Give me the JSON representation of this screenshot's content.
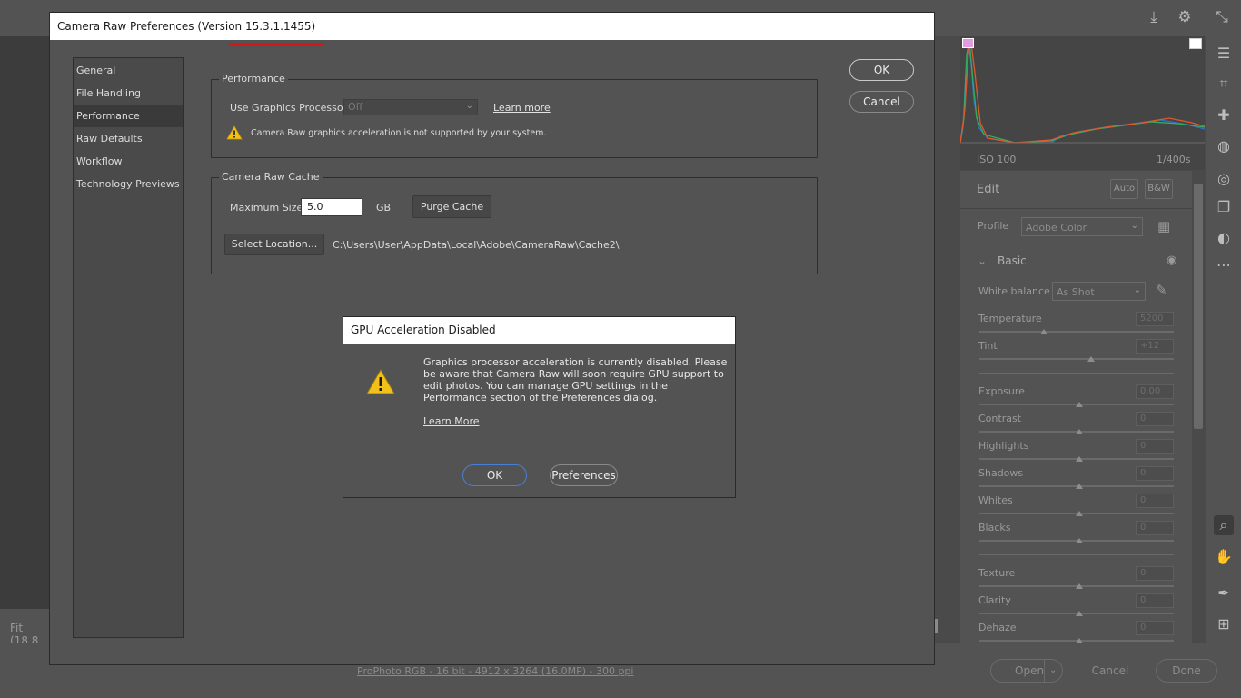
{
  "background": {
    "zoom_label": "Fit (18.8",
    "histogram": {
      "iso": "ISO 100",
      "shutter": "1/400s"
    },
    "edit": {
      "title": "Edit",
      "auto_label": "Auto",
      "bw_label": "B&W"
    },
    "profile": {
      "label": "Profile",
      "value": "Adobe Color"
    },
    "basic": {
      "title": "Basic"
    },
    "white_balance": {
      "label": "White balance",
      "value": "As Shot"
    },
    "sliders": [
      {
        "label": "Temperature",
        "value": "5200"
      },
      {
        "label": "Tint",
        "value": "+12"
      },
      {
        "label": "Exposure",
        "value": "0.00"
      },
      {
        "label": "Contrast",
        "value": "0"
      },
      {
        "label": "Highlights",
        "value": "0"
      },
      {
        "label": "Shadows",
        "value": "0"
      },
      {
        "label": "Whites",
        "value": "0"
      },
      {
        "label": "Blacks",
        "value": "0"
      },
      {
        "label": "Texture",
        "value": "0"
      },
      {
        "label": "Clarity",
        "value": "0"
      },
      {
        "label": "Dehaze",
        "value": "0"
      }
    ],
    "file_info": "ProPhoto RGB - 16 bit - 4912 x 3264 (16.0MP) - 300 ppi",
    "bottom_buttons": {
      "open": "Open",
      "cancel": "Cancel",
      "done": "Done"
    }
  },
  "prefs": {
    "title": "Camera Raw Preferences  (Version 15.3.1.1455)",
    "nav": [
      "General",
      "File Handling",
      "Performance",
      "Raw Defaults",
      "Workflow",
      "Technology Previews"
    ],
    "active_nav": "Performance",
    "ok_label": "OK",
    "cancel_label": "Cancel",
    "performance": {
      "legend": "Performance",
      "gpu_label": "Use Graphics Processor:",
      "gpu_value": "Off",
      "learn_more": "Learn more",
      "warning": "Camera Raw graphics acceleration is not supported by your system."
    },
    "cache": {
      "legend": "Camera Raw Cache",
      "max_size_label": "Maximum Size:",
      "max_size_value": "5.0",
      "unit": "GB",
      "purge_label": "Purge Cache",
      "select_location_label": "Select Location...",
      "path": "C:\\Users\\User\\AppData\\Local\\Adobe\\CameraRaw\\Cache2\\"
    }
  },
  "gpu_dialog": {
    "title": "GPU Acceleration Disabled",
    "message": "Graphics processor acceleration is currently disabled. Please be aware that Camera Raw will soon require GPU support to edit photos. You can manage GPU settings in the Performance section of the Preferences dialog.",
    "learn_more": "Learn More",
    "ok_label": "OK",
    "preferences_label": "Preferences"
  },
  "colors": {
    "accent_red": "#d41818",
    "focus_blue": "#4a7fd6",
    "warning_yellow": "#f2c019"
  }
}
